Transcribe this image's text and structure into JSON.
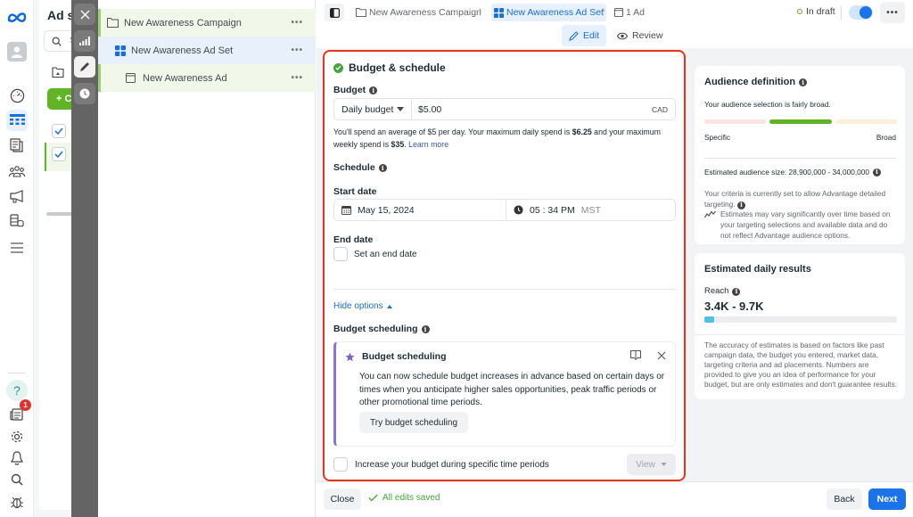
{
  "rail": {
    "logo": "meta-logo",
    "badge_count": "1",
    "top_icons": [
      "dashboard-icon",
      "campaigns-table-icon",
      "pages-icon",
      "audiences-icon",
      "megaphone-icon",
      "billing-icon",
      "menu-icon"
    ],
    "bottom_icons": [
      "help-icon",
      "news-icon",
      "settings-icon",
      "notifications-icon",
      "search-icon",
      "bug-icon"
    ]
  },
  "adsets_panel": {
    "title": "Ad sets",
    "search_placeholder": "Search",
    "create_label": "+ Create"
  },
  "dark_toolbar": {
    "buttons": [
      "close",
      "charts",
      "edit",
      "history"
    ]
  },
  "tree": {
    "campaign": "New Awareness Campaign",
    "adset": "New Awareness Ad Set",
    "ad": "New Awareness Ad",
    "more": "•••"
  },
  "topbar": {
    "breadcrumbs": [
      {
        "label": "New Awareness Campaign"
      },
      {
        "label": "New Awareness Ad Set"
      },
      {
        "label": "1 Ad"
      }
    ],
    "status": "In draft",
    "toggle_on": true,
    "more": "•••",
    "modes": [
      {
        "label": "Edit",
        "active": true
      },
      {
        "label": "Review",
        "active": false
      }
    ]
  },
  "budget_schedule": {
    "title": "Budget & schedule",
    "budget_label": "Budget",
    "budget_type": "Daily budget",
    "budget_value": "$5.00",
    "currency": "CAD",
    "helper_pre": "You'll spend an average of $5 per day. Your maximum daily spend is ",
    "helper_daily_max": "$6.25",
    "helper_mid": " and your maximum weekly spend is ",
    "helper_weekly_max": "$35",
    "helper_post": ". ",
    "learn_more": "Learn more",
    "schedule_label": "Schedule",
    "start_date_label": "Start date",
    "start_date": "May 15, 2024",
    "start_time": "05 : 34 PM",
    "timezone": "MST",
    "end_date_label": "End date",
    "end_date_checkbox": "Set an end date",
    "hide_options": "Hide options",
    "budget_scheduling_label": "Budget scheduling",
    "promo": {
      "title": "Budget scheduling",
      "body": "You can now schedule budget increases in advance based on certain days or times when you anticipate higher sales opportunities, peak traffic periods or other promotional time periods.",
      "button": "Try budget scheduling"
    },
    "increase_checkbox": "Increase your budget during specific time periods",
    "view_button": "View"
  },
  "audience": {
    "title": "Audience definition",
    "summary": "Your audience selection is fairly broad.",
    "scale_left": "Specific",
    "scale_right": "Broad",
    "breadth_segment": "middle",
    "size_text": "Estimated audience size: 28,900,000 - 34,000,000",
    "criteria_text": "Your criteria is currently set to allow Advantage detailed targeting.",
    "estimates_note": "Estimates may vary significantly over time based on your targeting selections and available data and do not reflect Advantage audience options."
  },
  "daily_results": {
    "title": "Estimated daily results",
    "reach_label": "Reach",
    "reach_value": "3.4K - 9.7K",
    "reach_fill_fraction": 0.05,
    "disclaimer": "The accuracy of estimates is based on factors like past campaign data, the budget you entered, market data, targeting criteria and ad placements. Numbers are provided to give you an idea of performance for your budget, but are only estimates and don't guarantee results."
  },
  "footer": {
    "close": "Close",
    "saved": "All edits saved",
    "back": "Back",
    "next": "Next"
  },
  "colors": {
    "accent_blue": "#1a73e8",
    "success_green": "#46a33d",
    "highlight_red": "#e8341c",
    "promo_purple": "#8a74d6",
    "reach_bar": "#4cc0e6"
  }
}
